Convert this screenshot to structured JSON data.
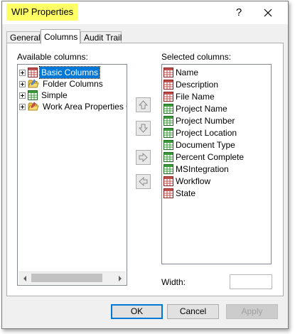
{
  "window": {
    "title": "WIP Properties",
    "help_label": "?"
  },
  "tabs": [
    {
      "label": "General"
    },
    {
      "label": "Columns"
    },
    {
      "label": "Audit Trail"
    }
  ],
  "available": {
    "label": "Available columns:",
    "items": [
      {
        "label": "Basic Columns",
        "icon": "table-icon"
      },
      {
        "label": "Folder Columns",
        "icon": "folder-icon"
      },
      {
        "label": "Simple",
        "icon": "table-green-icon"
      },
      {
        "label": "Work Area Properties C",
        "icon": "folder-icon"
      }
    ]
  },
  "selected": {
    "label": "Selected columns:",
    "items": [
      {
        "label": "Name",
        "icon": "table-red-icon"
      },
      {
        "label": "Description",
        "icon": "table-red-icon"
      },
      {
        "label": "File Name",
        "icon": "table-red-icon"
      },
      {
        "label": "Project Name",
        "icon": "table-green-icon"
      },
      {
        "label": "Project Number",
        "icon": "table-green-icon"
      },
      {
        "label": "Project Location",
        "icon": "table-green-icon"
      },
      {
        "label": "Document Type",
        "icon": "table-green-icon"
      },
      {
        "label": "Percent Complete",
        "icon": "table-green-icon"
      },
      {
        "label": "MSIntegration",
        "icon": "table-green-icon"
      },
      {
        "label": "Workflow",
        "icon": "table-red-icon"
      },
      {
        "label": "State",
        "icon": "table-red-icon"
      }
    ]
  },
  "width": {
    "label": "Width:",
    "value": ""
  },
  "buttons": {
    "ok": "OK",
    "cancel": "Cancel",
    "apply": "Apply"
  },
  "colors": {
    "title_highlight": "#ffff66",
    "selection": "#0078d7",
    "red_icon": "#c0504d",
    "green_icon": "#3a9a3a"
  }
}
